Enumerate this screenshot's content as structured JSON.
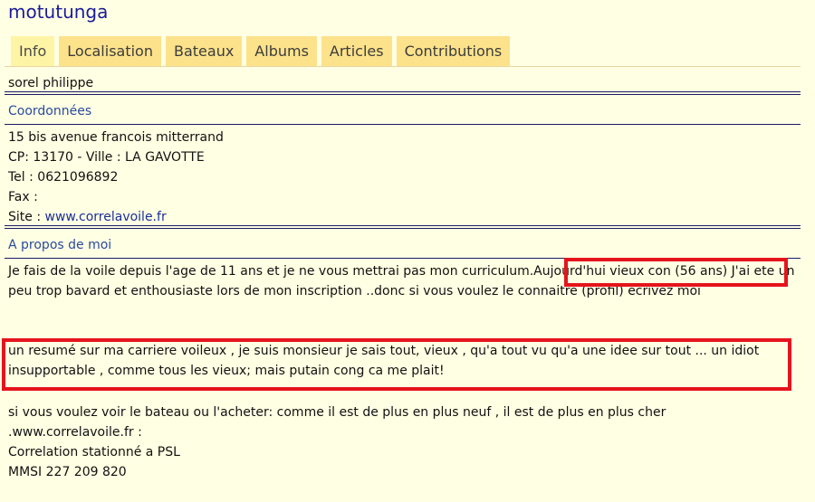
{
  "header": {
    "site_title": "motutunga"
  },
  "tabs": [
    {
      "label": "Info",
      "active": true
    },
    {
      "label": "Localisation",
      "active": false
    },
    {
      "label": "Bateaux",
      "active": false
    },
    {
      "label": "Albums",
      "active": false
    },
    {
      "label": "Articles",
      "active": false
    },
    {
      "label": "Contributions",
      "active": false
    }
  ],
  "profile": {
    "name": "sorel philippe"
  },
  "coordonnees": {
    "title": "Coordonnées",
    "address": "15 bis avenue francois mitterrand",
    "cp_ville": "CP: 13170 - Ville : LA GAVOTTE",
    "tel": "Tel : 0621096892",
    "fax": "Fax :",
    "site_prefix": "Site : ",
    "site_link": "www.correlavoile.fr"
  },
  "about": {
    "title": "A propos de moi",
    "p1_before": "Je fais de la voile depuis l'age de 11 ans et je ne vous mettrai pas mon curriculum.",
    "p1_highlight": "Aujourd'hui vieux con (56 ans)",
    "p1_after": " J'ai ete un peu trop bavard et enthousiaste lors de mon inscription ..donc si vous voulez le connaitre (profil) ecrivez moi",
    "p2": "un resumé sur ma carriere voileux , je suis monsieur je sais tout, vieux , qu'a tout vu qu'a une idee sur tout ... un idiot insupportable , comme tous les vieux; mais putain cong ca me plait!",
    "p3_line1": "si vous voulez voir le bateau ou l'acheter: comme il est de plus en plus neuf , il est de plus en plus cher",
    "p3_line2": ".www.correlavoile.fr :",
    "p3_line3": "Correlation stationné a PSL",
    "p3_line4": "MMSI 227 209 820"
  },
  "colors": {
    "background": "#ffffe3",
    "tab_bg": "#fde28c",
    "tab_active_bg": "#fef4a6",
    "title_blue": "#1b1b9a",
    "highlight_red": "#e5141c"
  }
}
